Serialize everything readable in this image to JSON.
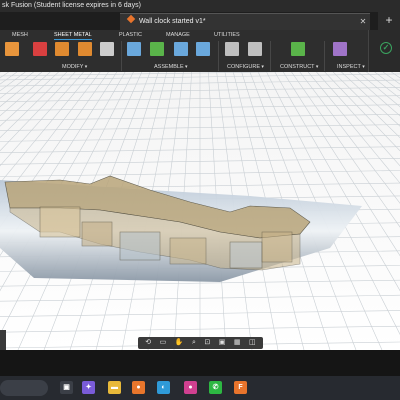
{
  "window": {
    "title": "sk Fusion (Student license expires in 6 days)"
  },
  "document_tab": {
    "title": "Wall clock started v1*",
    "close_glyph": "✕",
    "add_glyph": "+"
  },
  "ribbon": {
    "tabs": [
      {
        "label": "MESH",
        "active": false
      },
      {
        "label": "SHEET METAL",
        "active": true
      },
      {
        "label": "PLASTIC",
        "active": false
      },
      {
        "label": "MANAGE",
        "active": false
      },
      {
        "label": "UTILITIES",
        "active": false
      }
    ],
    "groups": [
      {
        "label": "MODIFY"
      },
      {
        "label": "ASSEMBLE"
      },
      {
        "label": "CONFIGURE"
      },
      {
        "label": "CONSTRUCT"
      },
      {
        "label": "INSPECT"
      }
    ],
    "tools": [
      {
        "icon": "fillet-tool-icon",
        "color": "#e8953c"
      },
      {
        "icon": "delete-icon",
        "color": "#d94040"
      },
      {
        "icon": "split-body-icon",
        "color": "#e08a30"
      },
      {
        "icon": "split-face-icon",
        "color": "#e08a30"
      },
      {
        "icon": "scissors-icon",
        "color": "#cccccc"
      },
      {
        "icon": "new-component-icon",
        "color": "#6aa8dc"
      },
      {
        "icon": "joint-icon",
        "color": "#5ab44a"
      },
      {
        "icon": "as-built-joint-icon",
        "color": "#6aa8dc"
      },
      {
        "icon": "motion-link-icon",
        "color": "#6aa8dc"
      },
      {
        "icon": "configure-icon",
        "color": "#bfbfbf"
      },
      {
        "icon": "table-icon",
        "color": "#bfbfbf"
      },
      {
        "icon": "offset-plane-icon",
        "color": "#5ab44a"
      },
      {
        "icon": "inspect-icon",
        "color": "#a074c8"
      }
    ]
  },
  "status": {
    "icon": "check-circle-icon",
    "color": "#3aa35f"
  },
  "navbar": {
    "items": [
      {
        "icon": "orbit-icon",
        "glyph": "⟲"
      },
      {
        "icon": "look-at-icon",
        "glyph": "▭"
      },
      {
        "icon": "pan-icon",
        "glyph": "✋"
      },
      {
        "icon": "zoom-icon",
        "glyph": "⌕"
      },
      {
        "icon": "fit-icon",
        "glyph": "⊡"
      },
      {
        "icon": "display-settings-icon",
        "glyph": "▣"
      },
      {
        "icon": "grid-icon",
        "glyph": "▦"
      },
      {
        "icon": "viewports-icon",
        "glyph": "◫"
      }
    ]
  },
  "taskbar": {
    "apps": [
      {
        "icon": "task-view-icon",
        "glyph": "▣",
        "color": "#3b3f47"
      },
      {
        "icon": "copilot-icon",
        "glyph": "✦",
        "color": "#7a5cd8"
      },
      {
        "icon": "file-explorer-icon",
        "glyph": "▬",
        "color": "#e8b93a"
      },
      {
        "icon": "firefox-icon",
        "glyph": "●",
        "color": "#e8762c"
      },
      {
        "icon": "edge-icon",
        "glyph": "◐",
        "color": "#2f9ad8"
      },
      {
        "icon": "goose-icon",
        "glyph": "●",
        "color": "#d04090"
      },
      {
        "icon": "whatsapp-icon",
        "glyph": "✆",
        "color": "#2db742"
      },
      {
        "icon": "fusion-icon",
        "glyph": "F",
        "color": "#e8742c"
      }
    ]
  }
}
